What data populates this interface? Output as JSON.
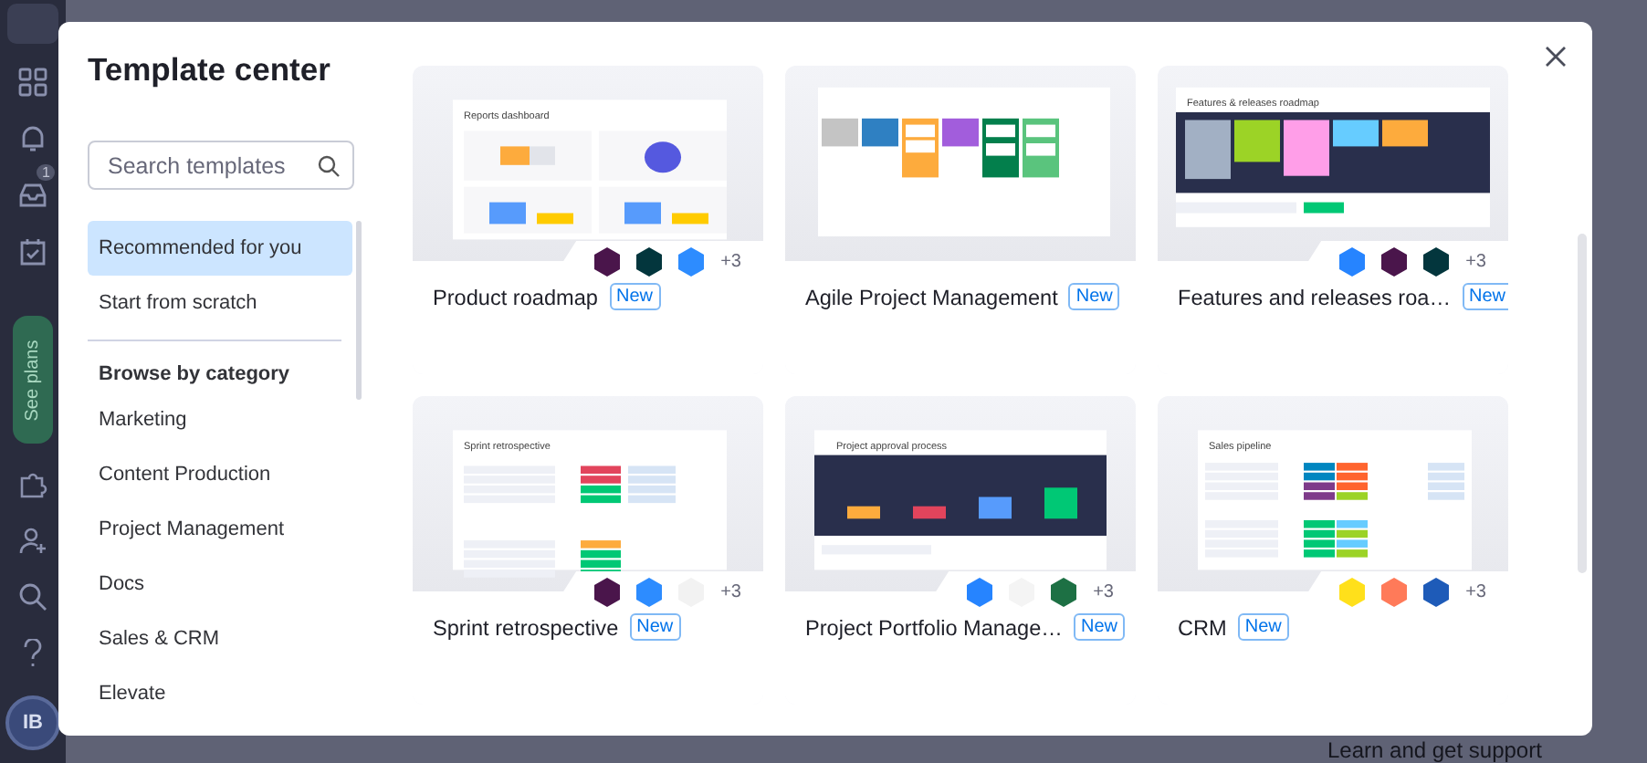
{
  "rail": {
    "badge": "1",
    "see_plans": "See plans",
    "avatar": "IB"
  },
  "backdrop_text": "Learn and get support",
  "modal": {
    "title": "Template center",
    "search": {
      "placeholder": "Search templates"
    },
    "top_items": [
      {
        "label": "Recommended for you",
        "selected": true
      },
      {
        "label": "Start from scratch",
        "selected": false
      }
    ],
    "category_heading": "Browse by category",
    "categories": [
      {
        "label": "Marketing",
        "selected": false
      },
      {
        "label": "Content Production",
        "selected": false
      },
      {
        "label": "Project Management",
        "selected": false
      },
      {
        "label": "Docs",
        "selected": false
      },
      {
        "label": "Sales & CRM",
        "selected": false
      },
      {
        "label": "Elevate",
        "selected": false
      }
    ],
    "templates": [
      {
        "name": "Product roadmap",
        "badge": "New",
        "kind": "dashboard",
        "preview_title": "Reports dashboard",
        "integrations": [
          {
            "color": "#4a154b"
          },
          {
            "color": "#03363d"
          },
          {
            "color": "#2d8cff"
          }
        ],
        "more": "+3"
      },
      {
        "name": "Agile Project Management",
        "badge": "New",
        "kind": "kanban"
      },
      {
        "name": "Features and releases roa…",
        "badge": "New",
        "kind": "kanban-dark",
        "preview_title": "Features & releases roadmap",
        "integrations": [
          {
            "color": "#2684ff"
          },
          {
            "color": "#4a154b"
          },
          {
            "color": "#03363d"
          }
        ],
        "more": "+3"
      },
      {
        "name": "Sprint retrospective",
        "badge": "New",
        "kind": "table",
        "preview_title": "Sprint retrospective",
        "integrations": [
          {
            "color": "#4a154b"
          },
          {
            "color": "#2d8cff"
          },
          {
            "color": "#f2f2f2"
          }
        ],
        "more": "+3"
      },
      {
        "name": "Project Portfolio Manage…",
        "badge": "New",
        "kind": "chart",
        "preview_title": "Project approval process",
        "integrations": [
          {
            "color": "#2684ff"
          },
          {
            "color": "#f4f4f4"
          },
          {
            "color": "#1d7044"
          }
        ],
        "more": "+3"
      },
      {
        "name": "CRM",
        "badge": "New",
        "kind": "crm",
        "preview_title": "Sales pipeline",
        "integrations": [
          {
            "color": "#ffe01b"
          },
          {
            "color": "#ff7a59"
          },
          {
            "color": "#1e5bb8"
          }
        ],
        "more": "+3"
      }
    ]
  }
}
